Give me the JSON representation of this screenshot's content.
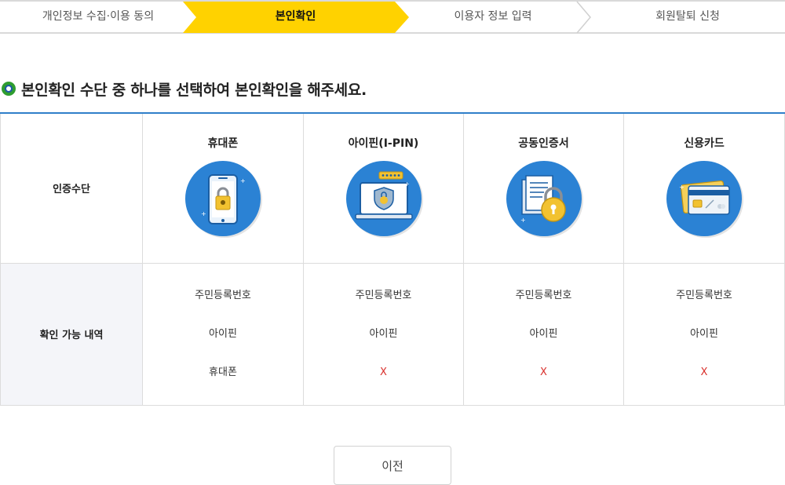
{
  "steps": [
    {
      "label": "개인정보 수집·이용 동의",
      "active": false
    },
    {
      "label": "본인확인",
      "active": true
    },
    {
      "label": "이용자 정보 입력",
      "active": false
    },
    {
      "label": "회원탈퇴 신청",
      "active": false
    }
  ],
  "colors": {
    "active_step": "#ffd200",
    "table_top_border": "#2f7fc9",
    "icon_circle": "#2b82d4",
    "unavailable_mark": "#d9302c"
  },
  "heading": "본인확인 수단 중 하나를 선택하여 본인확인을 해주세요.",
  "table": {
    "method_row_label": "인증수단",
    "avail_row_label": "확인 가능 내역",
    "methods": [
      {
        "name": "휴대폰",
        "icon": "smartphone-lock-icon",
        "available": [
          "주민등록번호",
          "아이핀",
          "휴대폰"
        ]
      },
      {
        "name": "아이핀(I-PIN)",
        "icon": "ipin-monitor-shield-icon",
        "available": [
          "주민등록번호",
          "아이핀",
          "X"
        ]
      },
      {
        "name": "공동인증서",
        "icon": "certificate-lock-icon",
        "available": [
          "주민등록번호",
          "아이핀",
          "X"
        ]
      },
      {
        "name": "신용카드",
        "icon": "credit-card-icon",
        "available": [
          "주민등록번호",
          "아이핀",
          "X"
        ]
      }
    ]
  },
  "prev_button": "이전"
}
